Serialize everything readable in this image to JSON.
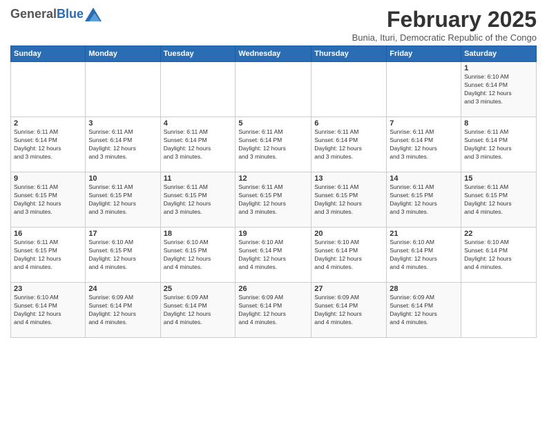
{
  "logo": {
    "general": "General",
    "blue": "Blue"
  },
  "title": "February 2025",
  "subtitle": "Bunia, Ituri, Democratic Republic of the Congo",
  "days_of_week": [
    "Sunday",
    "Monday",
    "Tuesday",
    "Wednesday",
    "Thursday",
    "Friday",
    "Saturday"
  ],
  "weeks": [
    [
      {
        "day": "",
        "info": ""
      },
      {
        "day": "",
        "info": ""
      },
      {
        "day": "",
        "info": ""
      },
      {
        "day": "",
        "info": ""
      },
      {
        "day": "",
        "info": ""
      },
      {
        "day": "",
        "info": ""
      },
      {
        "day": "1",
        "info": "Sunrise: 6:10 AM\nSunset: 6:14 PM\nDaylight: 12 hours\nand 3 minutes."
      }
    ],
    [
      {
        "day": "2",
        "info": "Sunrise: 6:11 AM\nSunset: 6:14 PM\nDaylight: 12 hours\nand 3 minutes."
      },
      {
        "day": "3",
        "info": "Sunrise: 6:11 AM\nSunset: 6:14 PM\nDaylight: 12 hours\nand 3 minutes."
      },
      {
        "day": "4",
        "info": "Sunrise: 6:11 AM\nSunset: 6:14 PM\nDaylight: 12 hours\nand 3 minutes."
      },
      {
        "day": "5",
        "info": "Sunrise: 6:11 AM\nSunset: 6:14 PM\nDaylight: 12 hours\nand 3 minutes."
      },
      {
        "day": "6",
        "info": "Sunrise: 6:11 AM\nSunset: 6:14 PM\nDaylight: 12 hours\nand 3 minutes."
      },
      {
        "day": "7",
        "info": "Sunrise: 6:11 AM\nSunset: 6:14 PM\nDaylight: 12 hours\nand 3 minutes."
      },
      {
        "day": "8",
        "info": "Sunrise: 6:11 AM\nSunset: 6:14 PM\nDaylight: 12 hours\nand 3 minutes."
      }
    ],
    [
      {
        "day": "9",
        "info": "Sunrise: 6:11 AM\nSunset: 6:15 PM\nDaylight: 12 hours\nand 3 minutes."
      },
      {
        "day": "10",
        "info": "Sunrise: 6:11 AM\nSunset: 6:15 PM\nDaylight: 12 hours\nand 3 minutes."
      },
      {
        "day": "11",
        "info": "Sunrise: 6:11 AM\nSunset: 6:15 PM\nDaylight: 12 hours\nand 3 minutes."
      },
      {
        "day": "12",
        "info": "Sunrise: 6:11 AM\nSunset: 6:15 PM\nDaylight: 12 hours\nand 3 minutes."
      },
      {
        "day": "13",
        "info": "Sunrise: 6:11 AM\nSunset: 6:15 PM\nDaylight: 12 hours\nand 3 minutes."
      },
      {
        "day": "14",
        "info": "Sunrise: 6:11 AM\nSunset: 6:15 PM\nDaylight: 12 hours\nand 3 minutes."
      },
      {
        "day": "15",
        "info": "Sunrise: 6:11 AM\nSunset: 6:15 PM\nDaylight: 12 hours\nand 4 minutes."
      }
    ],
    [
      {
        "day": "16",
        "info": "Sunrise: 6:11 AM\nSunset: 6:15 PM\nDaylight: 12 hours\nand 4 minutes."
      },
      {
        "day": "17",
        "info": "Sunrise: 6:10 AM\nSunset: 6:15 PM\nDaylight: 12 hours\nand 4 minutes."
      },
      {
        "day": "18",
        "info": "Sunrise: 6:10 AM\nSunset: 6:15 PM\nDaylight: 12 hours\nand 4 minutes."
      },
      {
        "day": "19",
        "info": "Sunrise: 6:10 AM\nSunset: 6:14 PM\nDaylight: 12 hours\nand 4 minutes."
      },
      {
        "day": "20",
        "info": "Sunrise: 6:10 AM\nSunset: 6:14 PM\nDaylight: 12 hours\nand 4 minutes."
      },
      {
        "day": "21",
        "info": "Sunrise: 6:10 AM\nSunset: 6:14 PM\nDaylight: 12 hours\nand 4 minutes."
      },
      {
        "day": "22",
        "info": "Sunrise: 6:10 AM\nSunset: 6:14 PM\nDaylight: 12 hours\nand 4 minutes."
      }
    ],
    [
      {
        "day": "23",
        "info": "Sunrise: 6:10 AM\nSunset: 6:14 PM\nDaylight: 12 hours\nand 4 minutes."
      },
      {
        "day": "24",
        "info": "Sunrise: 6:09 AM\nSunset: 6:14 PM\nDaylight: 12 hours\nand 4 minutes."
      },
      {
        "day": "25",
        "info": "Sunrise: 6:09 AM\nSunset: 6:14 PM\nDaylight: 12 hours\nand 4 minutes."
      },
      {
        "day": "26",
        "info": "Sunrise: 6:09 AM\nSunset: 6:14 PM\nDaylight: 12 hours\nand 4 minutes."
      },
      {
        "day": "27",
        "info": "Sunrise: 6:09 AM\nSunset: 6:14 PM\nDaylight: 12 hours\nand 4 minutes."
      },
      {
        "day": "28",
        "info": "Sunrise: 6:09 AM\nSunset: 6:14 PM\nDaylight: 12 hours\nand 4 minutes."
      },
      {
        "day": "",
        "info": ""
      }
    ]
  ]
}
